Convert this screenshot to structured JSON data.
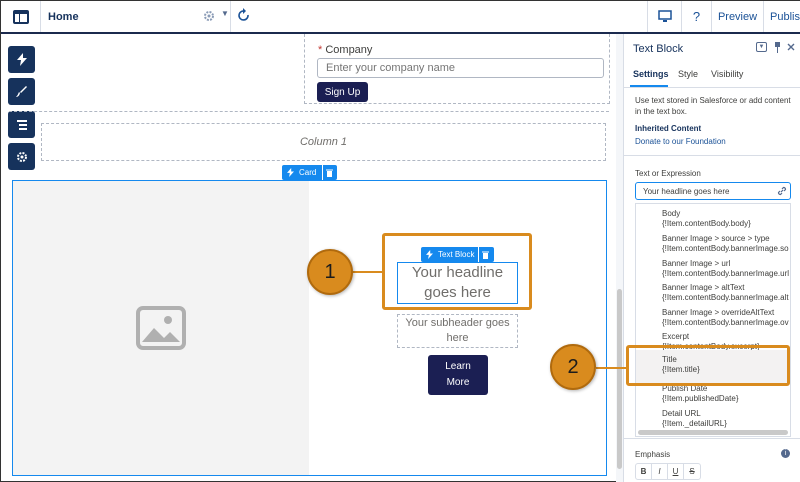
{
  "header": {
    "page_name": "Home",
    "preview_label": "Preview",
    "publish_label": "Publish"
  },
  "form": {
    "company_label": "Company",
    "company_required_mark": "*",
    "company_placeholder": "Enter your company name",
    "signup_label": "Sign Up"
  },
  "canvas": {
    "column_label": "Column 1",
    "card_chip_label": "Card",
    "textblock_chip_label": "Text Block",
    "headline": "Your headline goes here",
    "subheader": "Your subheader goes here",
    "learn_more": "Learn More"
  },
  "callouts": {
    "one": "1",
    "two": "2"
  },
  "panel": {
    "title": "Text Block",
    "tabs": [
      "Settings",
      "Style",
      "Visibility"
    ],
    "description": "Use text stored in Salesforce or add content in the text box.",
    "inherited_label": "Inherited Content",
    "inherited_value": "Donate to our Foundation",
    "expr_label": "Text or Expression",
    "expr_value": "Your headline goes here",
    "dropdown": [
      {
        "name": "Body",
        "expr": "{!Item.contentBody.body}"
      },
      {
        "name": "Banner Image > source > type",
        "expr": "{!Item.contentBody.bannerImage.so"
      },
      {
        "name": "Banner Image > url",
        "expr": "{!Item.contentBody.bannerImage.url"
      },
      {
        "name": "Banner Image > altText",
        "expr": "{!Item.contentBody.bannerImage.alt"
      },
      {
        "name": "Banner Image > overrideAltText",
        "expr": "{!Item.contentBody.bannerImage.ov"
      },
      {
        "name": "Excerpt",
        "expr": "{!Item.contentBody.excerpt}"
      },
      {
        "name": "Title",
        "expr": "{!Item.title}"
      },
      {
        "name": "Publish Date",
        "expr": "{!Item.publishedDate}"
      },
      {
        "name": "Detail URL",
        "expr": "{!Item._detailURL}"
      }
    ],
    "emphasis_label": "Emphasis",
    "format_buttons": [
      "B",
      "I",
      "U",
      "S"
    ]
  },
  "colors": {
    "brand_dark": "#16325c",
    "accent_blue": "#1589ee",
    "callout_orange": "#d98b1e",
    "button_navy": "#1b1f53"
  }
}
